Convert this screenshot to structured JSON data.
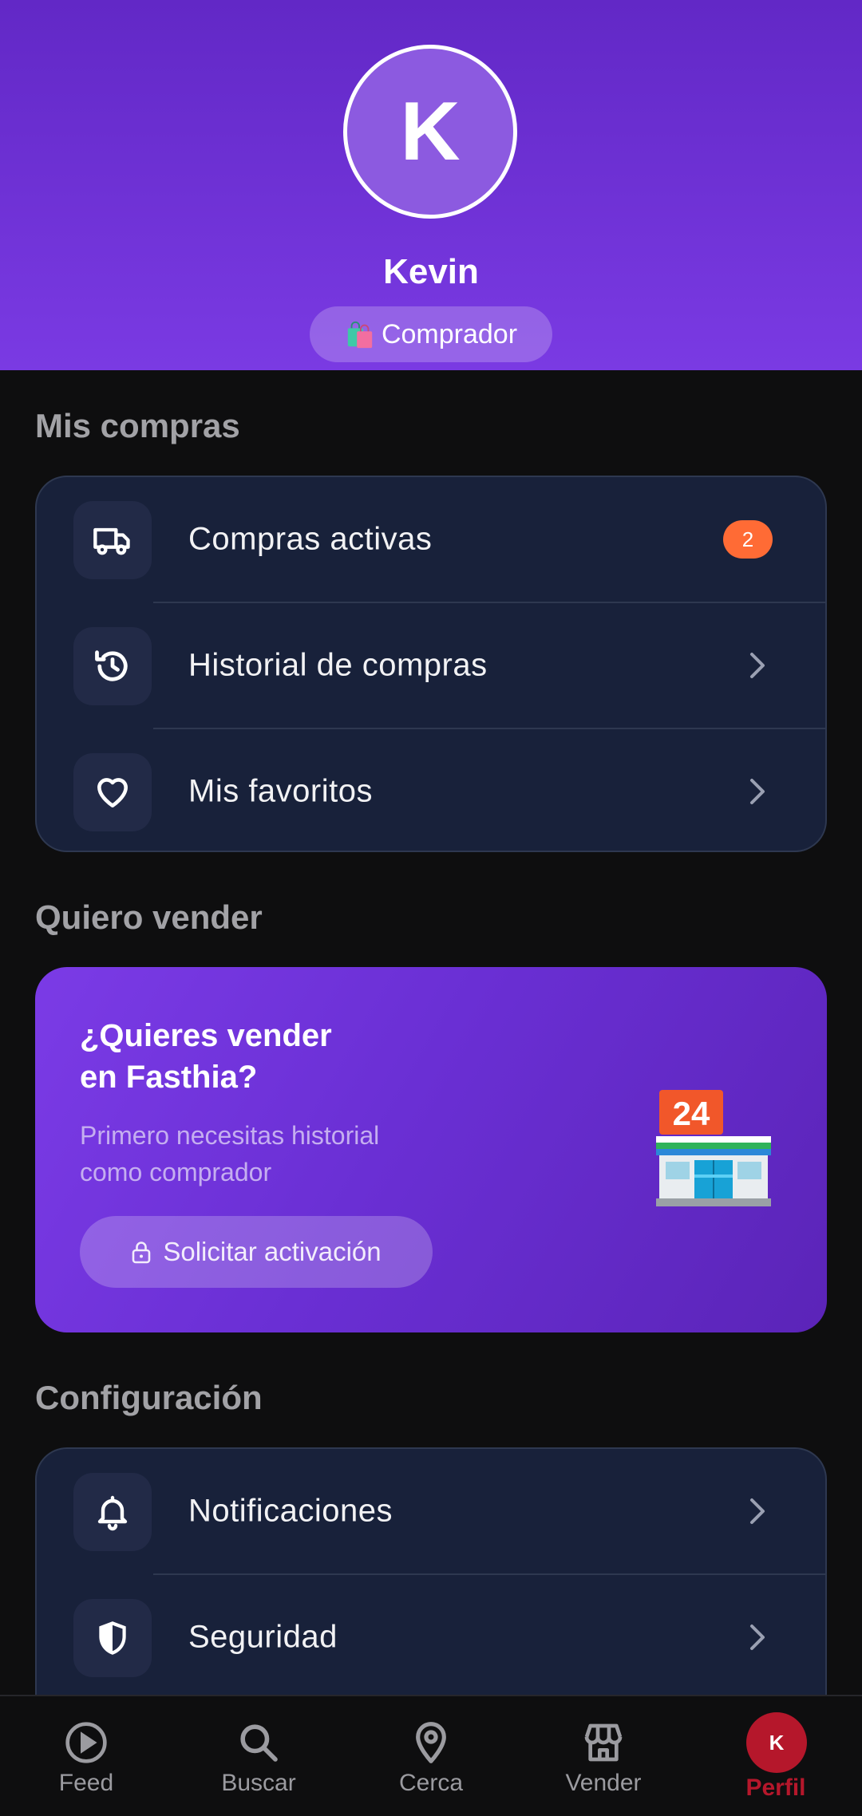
{
  "profile": {
    "initial": "K",
    "name": "Kevin",
    "role": "Comprador"
  },
  "purchases": {
    "title": "Mis compras",
    "items": [
      {
        "label": "Compras activas",
        "icon": "truck-icon",
        "badge": "2"
      },
      {
        "label": "Historial de compras",
        "icon": "history-icon"
      },
      {
        "label": "Mis favoritos",
        "icon": "heart-icon"
      }
    ]
  },
  "sell": {
    "title": "Quiero vender",
    "promo_title_line1": "¿Quieres vender",
    "promo_title_line2": "en Fasthia?",
    "promo_text_line1": "Primero necesitas historial",
    "promo_text_line2": "como comprador",
    "button_label": "Solicitar activación",
    "store_sign": "24"
  },
  "settings": {
    "title": "Configuración",
    "items": [
      {
        "label": "Notificaciones",
        "icon": "bell-icon"
      },
      {
        "label": "Seguridad",
        "icon": "shield-icon"
      }
    ]
  },
  "nav": {
    "items": [
      {
        "label": "Feed",
        "icon": "play-circle-icon"
      },
      {
        "label": "Buscar",
        "icon": "search-icon"
      },
      {
        "label": "Cerca",
        "icon": "location-pin-icon"
      },
      {
        "label": "Vender",
        "icon": "store-icon"
      },
      {
        "label": "Perfil",
        "icon": "avatar",
        "initial": "K"
      }
    ]
  },
  "colors": {
    "header": "#6f32d8",
    "card": "#18213a",
    "badge": "#ff6b35",
    "active_nav": "#b5172b"
  }
}
